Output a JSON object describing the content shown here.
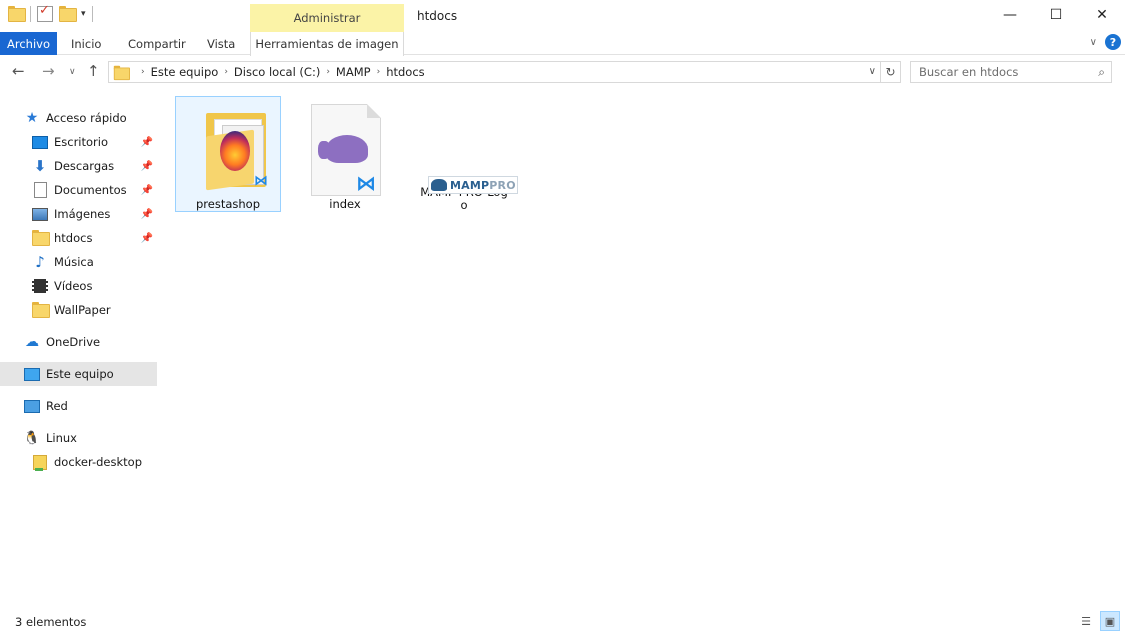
{
  "window": {
    "title": "htdocs",
    "context_tab_group": "Administrar",
    "minimize": "—",
    "maximize": "☐",
    "close": "✕"
  },
  "ribbon": {
    "tabs": [
      {
        "label": "Archivo"
      },
      {
        "label": "Inicio"
      },
      {
        "label": "Compartir"
      },
      {
        "label": "Vista"
      },
      {
        "label": "Herramientas de imagen"
      }
    ],
    "help": "?"
  },
  "address": {
    "breadcrumbs": [
      "Este equipo",
      "Disco local (C:)",
      "MAMP",
      "htdocs"
    ],
    "search_placeholder": "Buscar en htdocs"
  },
  "sidebar": {
    "items": [
      {
        "label": "Acceso rápido",
        "icon": "star-icon"
      },
      {
        "label": "Escritorio",
        "icon": "desktop-icon",
        "pinned": true
      },
      {
        "label": "Descargas",
        "icon": "download-icon",
        "pinned": true
      },
      {
        "label": "Documentos",
        "icon": "documents-icon",
        "pinned": true
      },
      {
        "label": "Imágenes",
        "icon": "pictures-icon",
        "pinned": true
      },
      {
        "label": "htdocs",
        "icon": "folder-icon",
        "pinned": true
      },
      {
        "label": "Música",
        "icon": "music-icon"
      },
      {
        "label": "Vídeos",
        "icon": "videos-icon"
      },
      {
        "label": "WallPaper",
        "icon": "folder-icon"
      },
      {
        "label": "OneDrive",
        "icon": "cloud-icon"
      },
      {
        "label": "Este equipo",
        "icon": "computer-icon",
        "selected": true
      },
      {
        "label": "Red",
        "icon": "network-icon"
      },
      {
        "label": "Linux",
        "icon": "linux-icon"
      },
      {
        "label": "docker-desktop",
        "icon": "drive-icon"
      }
    ]
  },
  "files": [
    {
      "name": "prestashop",
      "type": "folder",
      "selected": true
    },
    {
      "name": "index",
      "type": "php-file"
    },
    {
      "name": "MAMP-PRO-Logo",
      "type": "image"
    }
  ],
  "mamp_logo_text": {
    "mamp": "MAMP",
    "pro": "PRO"
  },
  "status": {
    "count": "3 elementos"
  },
  "colors": {
    "accent": "#1967d2",
    "context_tab": "#fbf3a7",
    "selection": "#cce8ff"
  }
}
